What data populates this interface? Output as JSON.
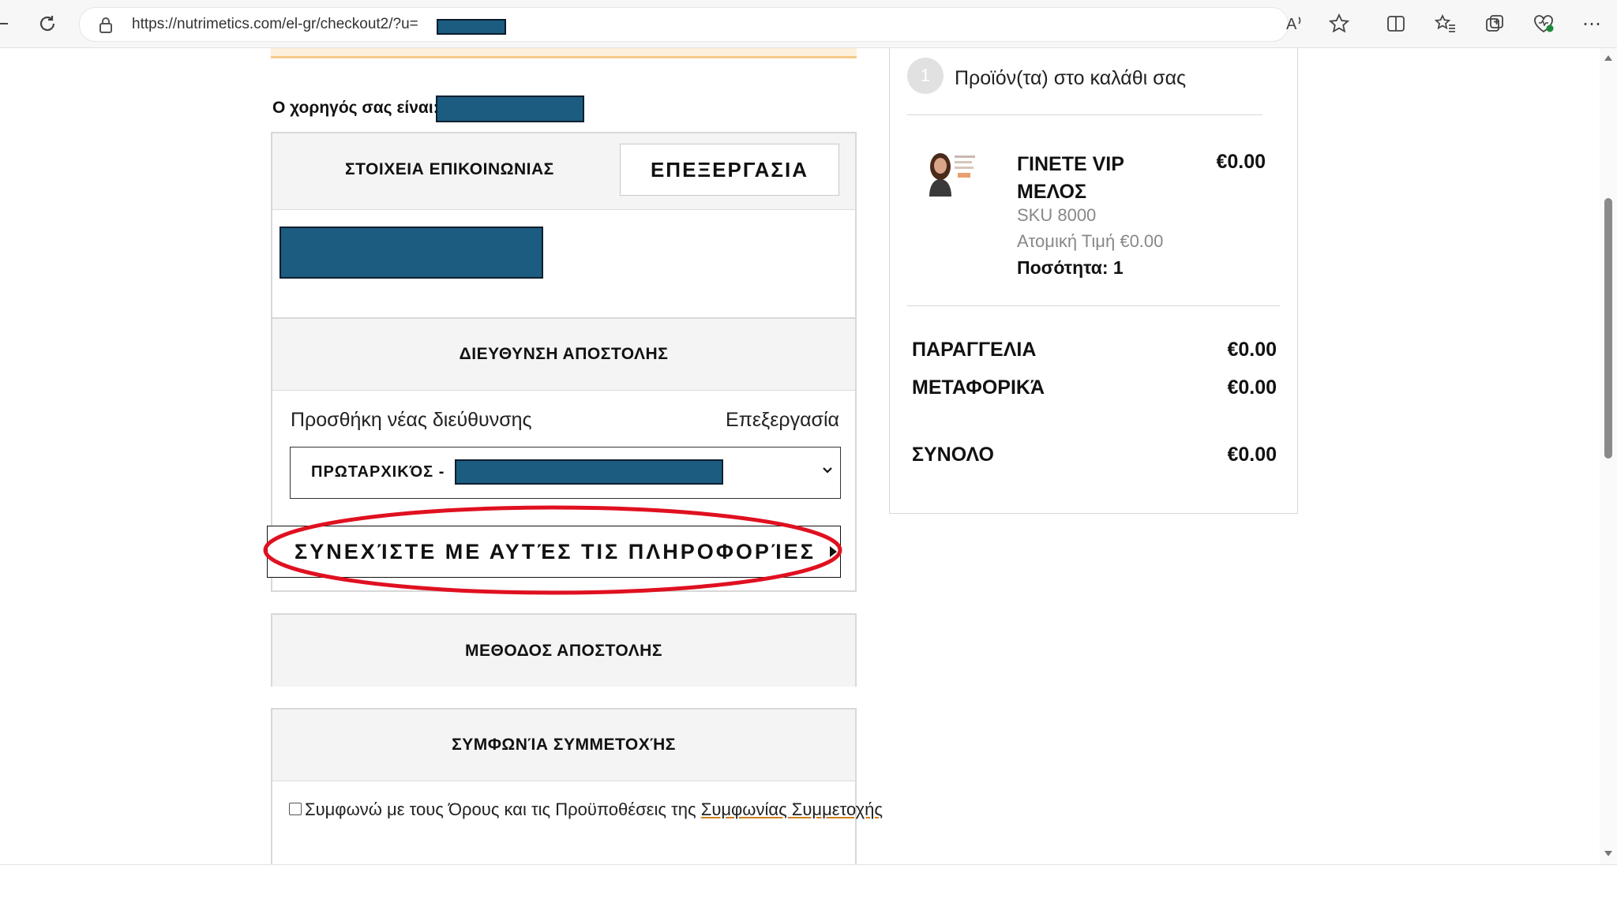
{
  "browser": {
    "url": "https://nutrimetics.com/el-gr/checkout2/?u=",
    "read_aloud_glyph": "A",
    "ellipsis": "⋯"
  },
  "sponsor": {
    "label": "Ο χορηγός σας είναι:"
  },
  "contact": {
    "title": "ΣΤΟΙΧΕΙΑ ΕΠΙΚΟΙΝΩΝΙΑΣ",
    "edit_label": "ΕΠΕΞΕΡΓΑΣΙΑ"
  },
  "shipping_address": {
    "title": "ΔΙΕΥΘΥΝΣΗ ΑΠΟΣΤΟΛΗΣ",
    "add_new": "Προσθήκη νέας διεύθυνσης",
    "edit": "Επεξεργασία",
    "selected_prefix": "ΠΡΩΤΑΡΧΙΚΌΣ - ",
    "continue_label": "ΣΥΝΕΧΊΣΤΕ ΜΕ ΑΥΤΈΣ ΤΙΣ ΠΛΗΡΟΦΟΡΊΕΣ"
  },
  "shipping_method": {
    "title": "ΜΕΘΟΔΟΣ ΑΠΟΣΤΟΛΗΣ"
  },
  "agreement": {
    "title": "ΣΥΜΦΩΝΊΑ ΣΥΜΜΕΤΟΧΉΣ",
    "checkbox_text": "Συμφωνώ με τους Όρους και τις Προϋποθέσεις της ",
    "link_text": "Συμφωνίας Συμμετοχής",
    "checked": false
  },
  "cart": {
    "step": "1",
    "title": "Προϊόν(τα) στο καλάθι σας",
    "item": {
      "name": "ΓΙΝΕΤΕ VIP ΜΕΛΟΣ",
      "price": "€0.00",
      "sku": "SKU 8000",
      "unit_price": "Ατομική Τιμή €0.00",
      "quantity": "Ποσότητα: 1"
    },
    "summary": {
      "order_label": "ΠΑΡΑΓΓΕΛΙΑ",
      "order_value": "€0.00",
      "shipping_label": "ΜΕΤΑΦΟΡΙΚΆ",
      "shipping_value": "€0.00",
      "total_label": "ΣΥΝΟΛΟ",
      "total_value": "€0.00"
    }
  },
  "colors": {
    "redaction": "#1b5c80",
    "highlight_circle": "#e01020",
    "alert_border": "#f6c98a"
  }
}
